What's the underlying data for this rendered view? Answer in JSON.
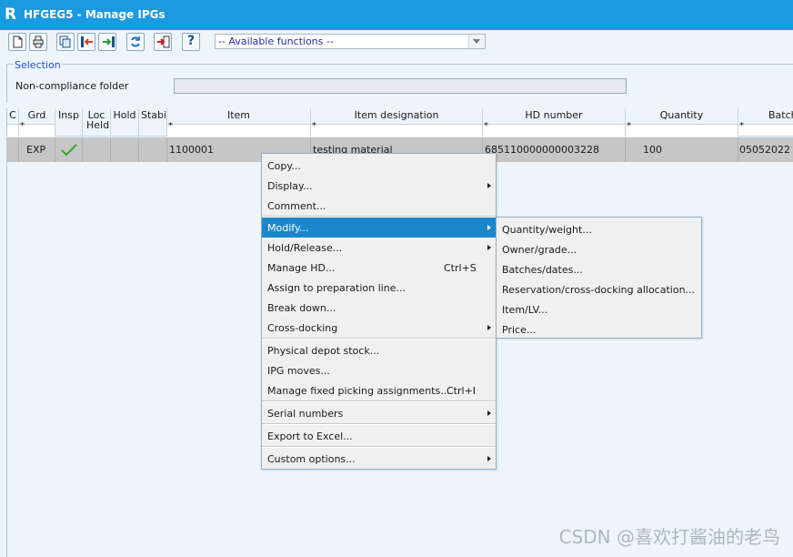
{
  "window": {
    "title": "HFGEG5 - Manage IPGs",
    "logo": "R"
  },
  "toolbar": {
    "buttons": [
      "new-icon",
      "print-icon",
      "copy-icon",
      "import-icon",
      "export-icon",
      "refresh-icon",
      "exit-icon",
      "help-icon"
    ],
    "help_label": "?",
    "functions_select": "-- Available functions --"
  },
  "selection": {
    "legend": "Selection",
    "ncf_label": "Non-compliance folder",
    "ncf_value": ""
  },
  "grid": {
    "columns": [
      {
        "label": "C"
      },
      {
        "label": "Grd"
      },
      {
        "label": "Insp"
      },
      {
        "label": "Loc Held"
      },
      {
        "label": "Hold"
      },
      {
        "label": "Stabili"
      },
      {
        "label": "Item"
      },
      {
        "label": "Item designation"
      },
      {
        "label": "HD number"
      },
      {
        "label": "Quantity"
      },
      {
        "label": "Batch"
      }
    ],
    "filter_marker": "*",
    "row": {
      "grd": "EXP",
      "insp": "check-icon",
      "item": "1100001",
      "designation": "testing material",
      "hd_number": "685110000000003228",
      "quantity": "100",
      "batch": "05052022"
    }
  },
  "context_menu": {
    "items": [
      {
        "label": "Copy..."
      },
      {
        "label": "Display...",
        "submenu": true
      },
      {
        "label": "Comment..."
      },
      {
        "label": "Modify...",
        "submenu": true,
        "active": true
      },
      {
        "label": "Hold/Release...",
        "submenu": true
      },
      {
        "label": "Manage HD...",
        "shortcut": "Ctrl+S"
      },
      {
        "label": "Assign to preparation line..."
      },
      {
        "label": "Break down..."
      },
      {
        "label": "Cross-docking",
        "submenu": true
      },
      {
        "label": "Physical depot stock..."
      },
      {
        "label": "IPG moves..."
      },
      {
        "label": "Manage fixed picking assignments...",
        "shortcut": "Ctrl+I"
      },
      {
        "label": "Serial numbers",
        "submenu": true
      },
      {
        "label": "Export to Excel..."
      },
      {
        "label": "Custom options...",
        "submenu": true
      }
    ]
  },
  "submenu": {
    "items": [
      {
        "label": "Quantity/weight..."
      },
      {
        "label": "Owner/grade..."
      },
      {
        "label": "Batches/dates..."
      },
      {
        "label": "Reservation/cross-docking allocation..."
      },
      {
        "label": "Item/LV..."
      },
      {
        "label": "Price..."
      }
    ]
  },
  "watermark": "CSDN @喜欢打酱油的老鸟",
  "colors": {
    "titlebar": "#1b9ae0",
    "menu_highlight": "#1b86cc",
    "background": "#edf5fa",
    "row": "#c6c6c6"
  }
}
